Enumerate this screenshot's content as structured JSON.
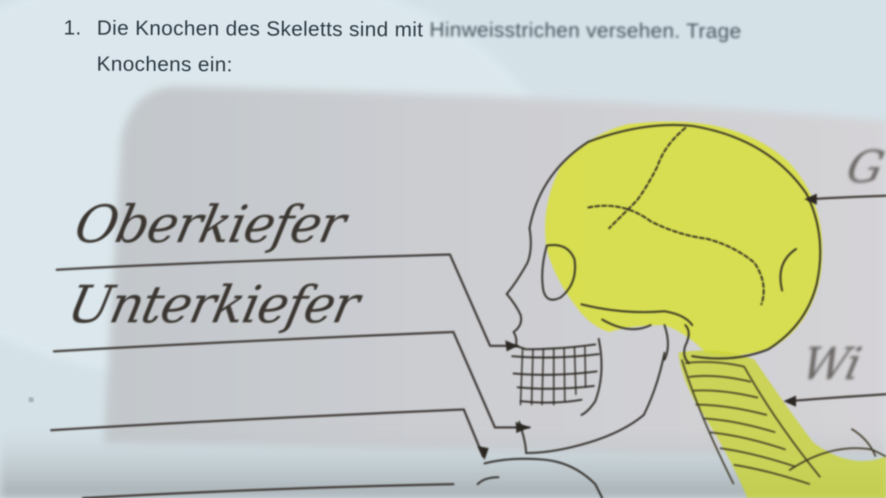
{
  "question": {
    "number": "1.",
    "line1_clear": "Die Knochen des Skeletts sind mit",
    "line1_blurred": "Hinweisstrichen versehen. Trage",
    "line2": "Knochens ein:"
  },
  "answers": {
    "answer_1": "Oberkiefer",
    "answer_2": "Unterkiefer",
    "right_label_1": "G",
    "right_label_2": "Wi"
  },
  "colors": {
    "paper": "#d8e4ea",
    "card": "#c9c9cd",
    "highlight": "#d6de3c",
    "ink": "#2b2622"
  }
}
